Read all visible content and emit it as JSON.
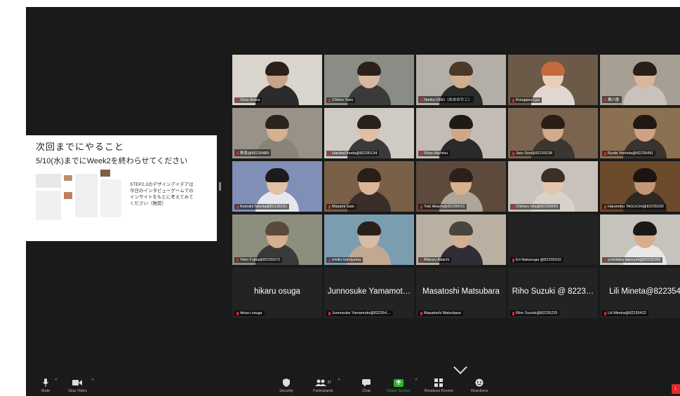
{
  "slide": {
    "title": "次回までにやること",
    "subtitle": "5/10(水)までにWeek2を終わらせてください",
    "note": "STEP2.2のデザインアイデアは\n今日のインタビューゲームでの\nインサイトをもとに考えてみて\nください（推奨）"
  },
  "participants": [
    {
      "name": "Shun Arima",
      "active": true,
      "bg": "#d9d4cc",
      "skin": "#c9a38a",
      "hair": "#2a1f1a",
      "shirt": "#2b2b2b"
    },
    {
      "name": "Chihiro Sato",
      "bg": "#8a8c86",
      "skin": "#d8b8a0",
      "hair": "#2a211c",
      "shirt": "#3a3a3a"
    },
    {
      "name": "Noriko ONO（おおのりこ）",
      "bg": "#b3aea6",
      "skin": "#d2ae90",
      "hair": "#4a3828",
      "shirt": "#2c2c2c"
    },
    {
      "name": "Rongqian Lyu",
      "bg": "#6b5a48",
      "skin": "#e8cdb8",
      "hair": "#c56a3c",
      "shirt": "#e0d8d0"
    },
    {
      "name": "黒川恵",
      "bg": "#a89f94",
      "skin": "#d9b79c",
      "hair": "#2a1e18",
      "shirt": "#c8c2ba"
    },
    {
      "name": "郁恵@82235489",
      "bg": "#9a9288",
      "skin": "#d6b092",
      "hair": "#2b221c",
      "shirt": "#8a8478"
    },
    {
      "name": "HarukaOnoda@82235134",
      "bg": "#cfcac2",
      "skin": "#e0c0a4",
      "hair": "#2a201a",
      "shirt": "#3a3a3a"
    },
    {
      "name": "Shun Hachisu",
      "bg": "#c2bcb4",
      "skin": "#cfa688",
      "hair": "#1e1a18",
      "shirt": "#2a2a2a"
    },
    {
      "name": "Jaru Son@82235238",
      "bg": "#7a6450",
      "skin": "#d4aa88",
      "hair": "#2a1e16",
      "shirt": "#3c3530"
    },
    {
      "name": "Ryota Yoshida@82235491",
      "bg": "#8c7052",
      "skin": "#cfa282",
      "hair": "#1f1814",
      "shirt": "#3a342e"
    },
    {
      "name": "KeisukeTakeda@82135161",
      "bg": "#7f8fb8",
      "skin": "#e2c0a2",
      "hair": "#1c1a1a",
      "shirt": "#e6e6f0"
    },
    {
      "name": "Masami Sato",
      "bg": "#7a6048",
      "skin": "#dcb598",
      "hair": "#2a1e16",
      "shirt": "#3a2f28"
    },
    {
      "name": "Yuki Akachi@82235015",
      "bg": "#5e4a3c",
      "skin": "#d8b090",
      "hair": "#2c201a",
      "shirt": "#b0a698"
    },
    {
      "name": "Chiharu Iida@82235043",
      "bg": "#c8c2ba",
      "skin": "#e4c6ac",
      "hair": "#3a3028",
      "shirt": "#d8d2ca"
    },
    {
      "name": "Harunobu TAGUCHI@82235292",
      "bg": "#6c4a2c",
      "skin": "#c49676",
      "hair": "#1c1410",
      "shirt": "#2e2822"
    },
    {
      "name": "Yoko Fujita@82235372",
      "bg": "#8c8f7e",
      "skin": "#d6ae90",
      "hair": "#5a4a3c",
      "shirt": "#3a3a3a"
    },
    {
      "name": "emiko kamiyama",
      "bg": "#7b9db0",
      "skin": "#d9bca4",
      "hair": "#2a201a",
      "shirt": "#c2a890"
    },
    {
      "name": "Mitsuru Adachi",
      "bg": "#b9b0a2",
      "skin": "#d4ae90",
      "hair": "#4a4440",
      "shirt": "#2e2e34"
    },
    {
      "name": "Eri Nakasuga @82235310",
      "dark": true
    },
    {
      "name": "yoshitaka takeuchi@82235266",
      "bg": "#c6c2bc",
      "skin": "#d6ae8e",
      "hair": "#1c1816",
      "shirt": "#e8e8e8"
    },
    {
      "name": "hikaru osuga",
      "dark": true,
      "bigname": "hikaru osuga"
    },
    {
      "name": "Junnosuke Yamamoto@822354…",
      "dark": true,
      "bigname": "Junnosuke Yamamot…"
    },
    {
      "name": "Masatoshi Matsubara",
      "dark": true,
      "bigname": "Masatoshi Matsubara"
    },
    {
      "name": "Riho Suzuki@82235225",
      "dark": true,
      "bigname": "Riho Suzuki @ 8223…"
    },
    {
      "name": "Lili Mineta@82235422",
      "dark": true,
      "bigname": "Lili Mineta@822354"
    }
  ],
  "toolbar": {
    "mute": "Mute",
    "stop_video": "Stop Video",
    "security": "Security",
    "participants": "Participants",
    "participants_count": "37",
    "chat": "Chat",
    "share_screen": "Share Screen",
    "breakout_rooms": "Breakout Rooms",
    "reactions": "Reactions",
    "leave": "L"
  },
  "colors": {
    "active_speaker": "#3fbf3f",
    "share_green": "#2db52d",
    "leave_red": "#e02828"
  }
}
